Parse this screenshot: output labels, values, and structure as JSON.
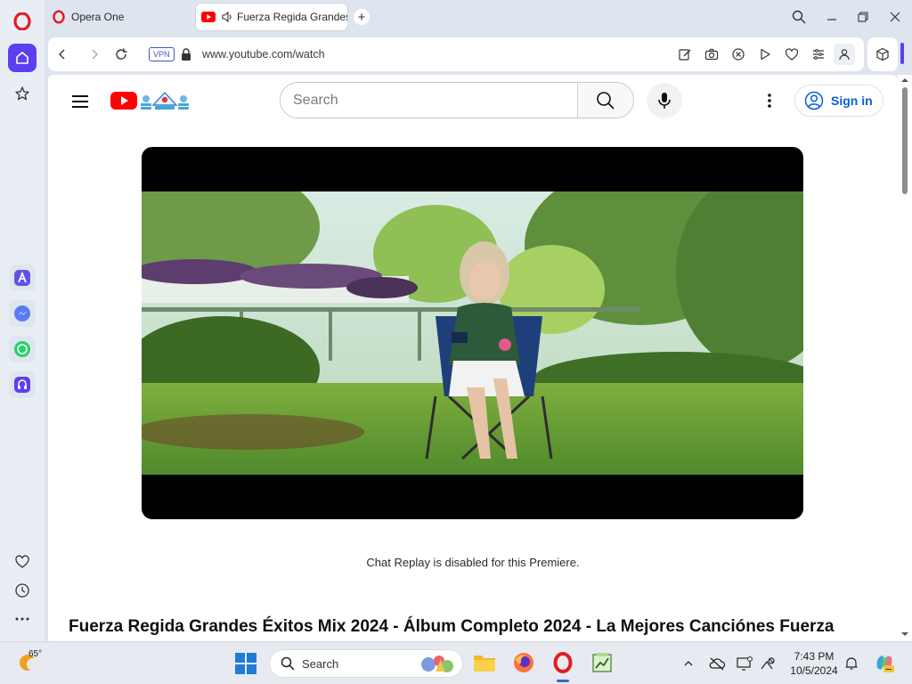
{
  "sidebar": {
    "icons": [
      "opera-logo",
      "home-icon",
      "star-icon",
      "aria-icon",
      "messenger-icon",
      "whatsapp-icon",
      "music-player-icon",
      "heart-icon",
      "history-icon",
      "more-icon"
    ]
  },
  "tabs": [
    {
      "label": "Opera One",
      "icon": "opera-logo"
    },
    {
      "label": "Fuerza Regida Grandes",
      "icon": "youtube-favicon",
      "audio": true
    }
  ],
  "toolbar": {
    "vpn_label": "VPN",
    "url": "www.youtube.com/watch"
  },
  "youtube": {
    "search_placeholder": "Search",
    "sign_in_label": "Sign in",
    "chat_note": "Chat Replay is disabled for this Premiere.",
    "video_title": "Fuerza Regida Grandes Éxitos Mix 2024 - Álbum Completo 2024 - La Mejores Canciónes Fuerza"
  },
  "taskbar": {
    "weather_temp": "65°",
    "search_label": "Search",
    "time": "7:43 PM",
    "date": "10/5/2024"
  },
  "colors": {
    "opera_red": "#e31b23",
    "accent_purple": "#5b3ff0",
    "youtube_red": "#ff0000",
    "link_blue": "#065fd4"
  }
}
